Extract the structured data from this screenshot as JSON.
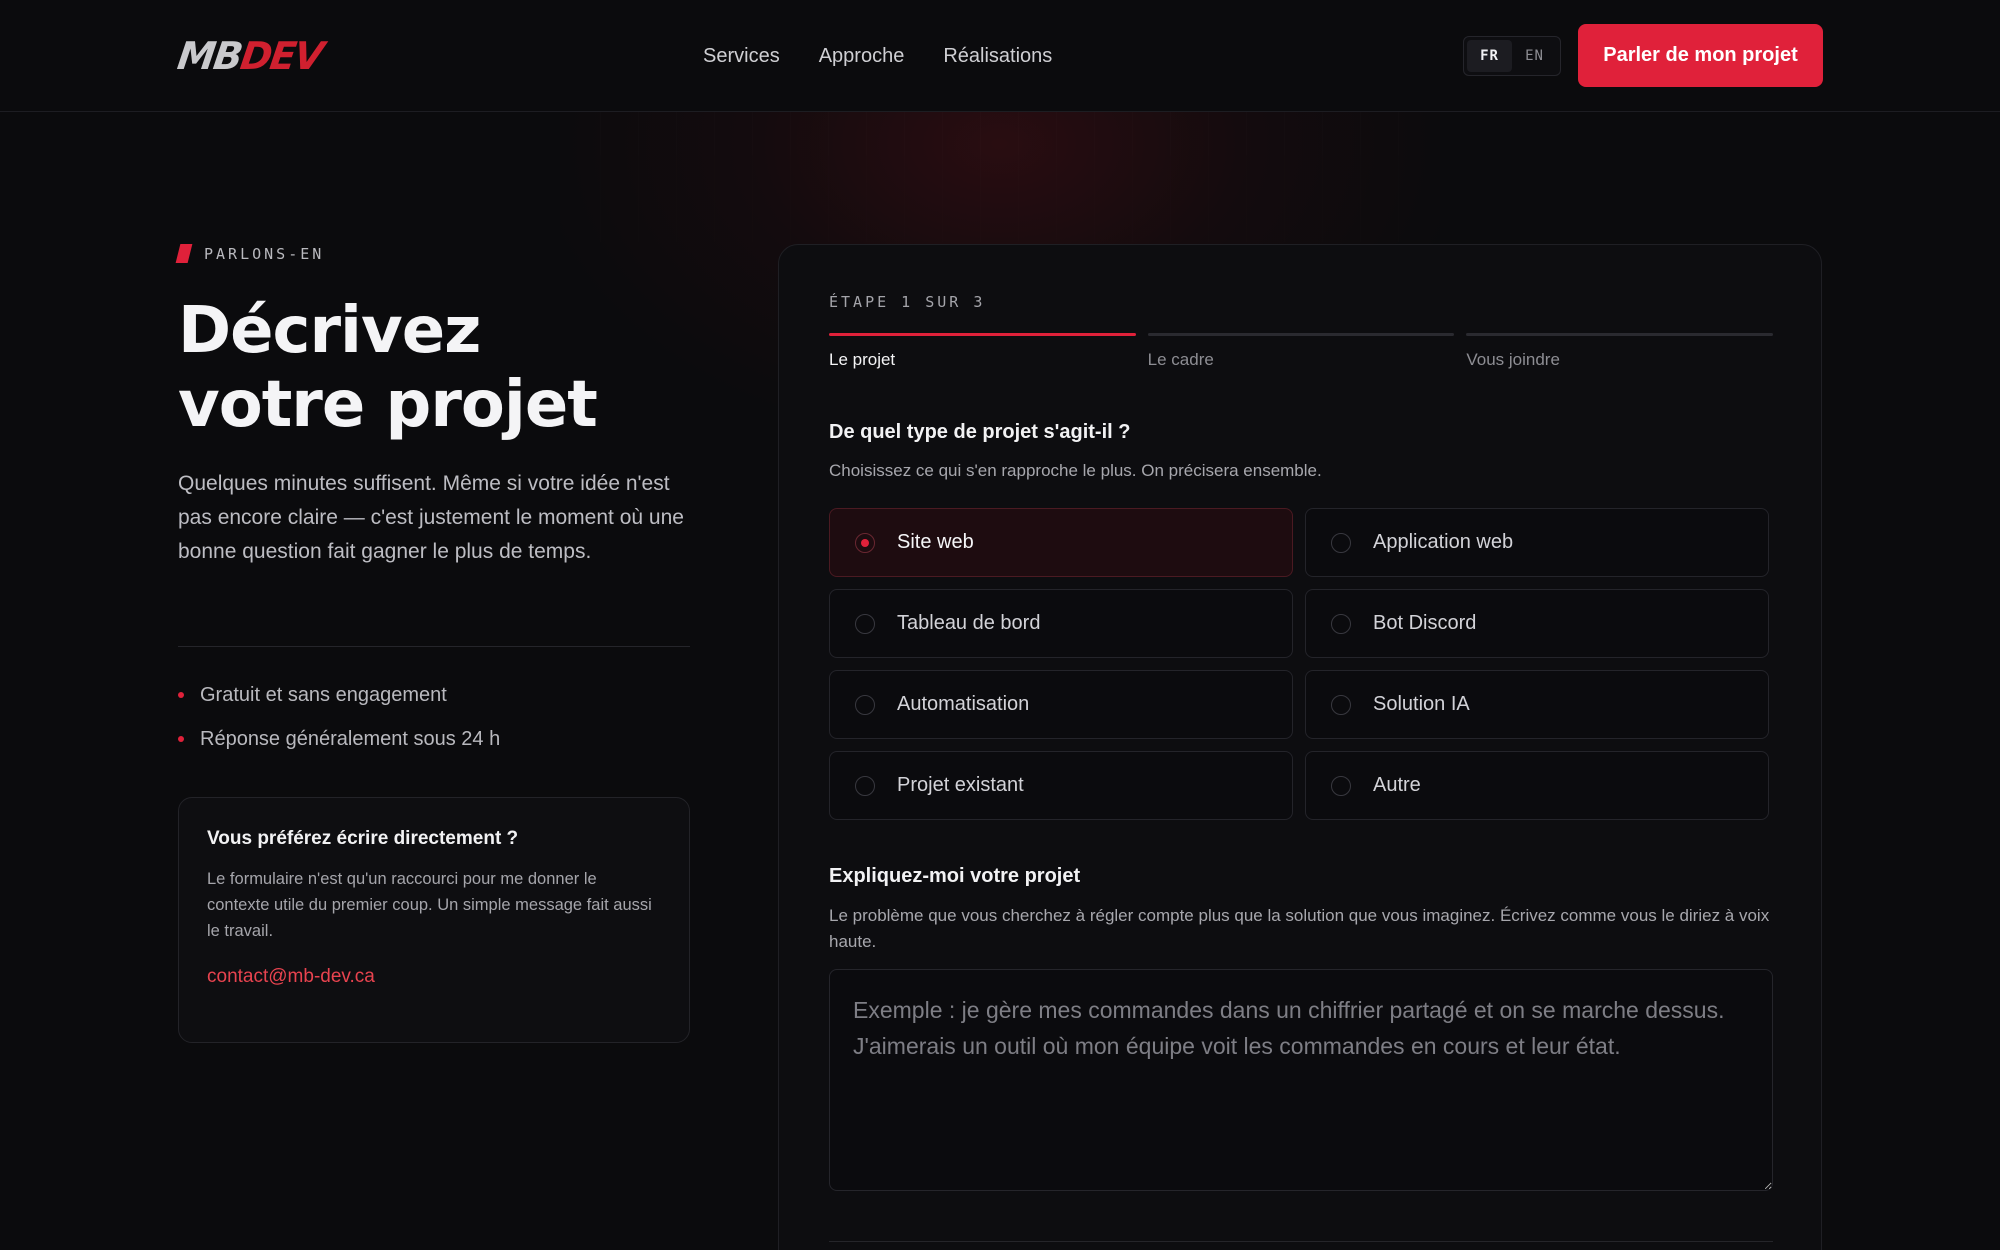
{
  "header": {
    "logo": {
      "part1": "MB",
      "part2": "DEV"
    },
    "nav": [
      "Services",
      "Approche",
      "Réalisations"
    ],
    "lang": {
      "active": "FR",
      "inactive": "EN"
    },
    "cta_label": "Parler de mon projet"
  },
  "intro": {
    "eyebrow": "PARLONS-EN",
    "title_line1": "Décrivez",
    "title_line2": "votre projet",
    "lead": "Quelques minutes suffisent. Même si votre idée n'est pas encore claire — c'est justement le moment où une bonne question fait gagner le plus de temps.",
    "bullets": [
      "Gratuit et sans engagement",
      "Réponse généralement sous 24 h"
    ]
  },
  "direct_contact": {
    "title": "Vous préférez écrire directement ?",
    "text": "Le formulaire n'est qu'un raccourci pour me donner le contexte utile du premier coup. Un simple message fait aussi le travail.",
    "email": "contact@mb-dev.ca"
  },
  "form": {
    "step_label": "ÉTAPE 1 SUR 3",
    "steps": [
      "Le projet",
      "Le cadre",
      "Vous joindre"
    ],
    "active_step": 0,
    "question_title": "De quel type de projet s'agit-il ?",
    "question_sub": "Choisissez ce qui s'en rapproche le plus. On précisera ensemble.",
    "options": [
      "Site web",
      "Application web",
      "Tableau de bord",
      "Bot Discord",
      "Automatisation",
      "Solution IA",
      "Projet existant",
      "Autre"
    ],
    "selected_option": "Site web",
    "explain_title": "Expliquez-moi votre projet",
    "explain_sub": "Le problème que vous cherchez à régler compte plus que la solution que vous imaginez. Écrivez comme vous le diriez à voix haute.",
    "textarea_placeholder": "Exemple : je gère mes commandes dans un chiffrier partagé et on se marche dessus. J'aimerais un outil où mon équipe voit les commandes en cours et leur état.",
    "textarea_value": ""
  },
  "colors": {
    "accent": "#e0213a",
    "background": "#0b0b0d"
  }
}
